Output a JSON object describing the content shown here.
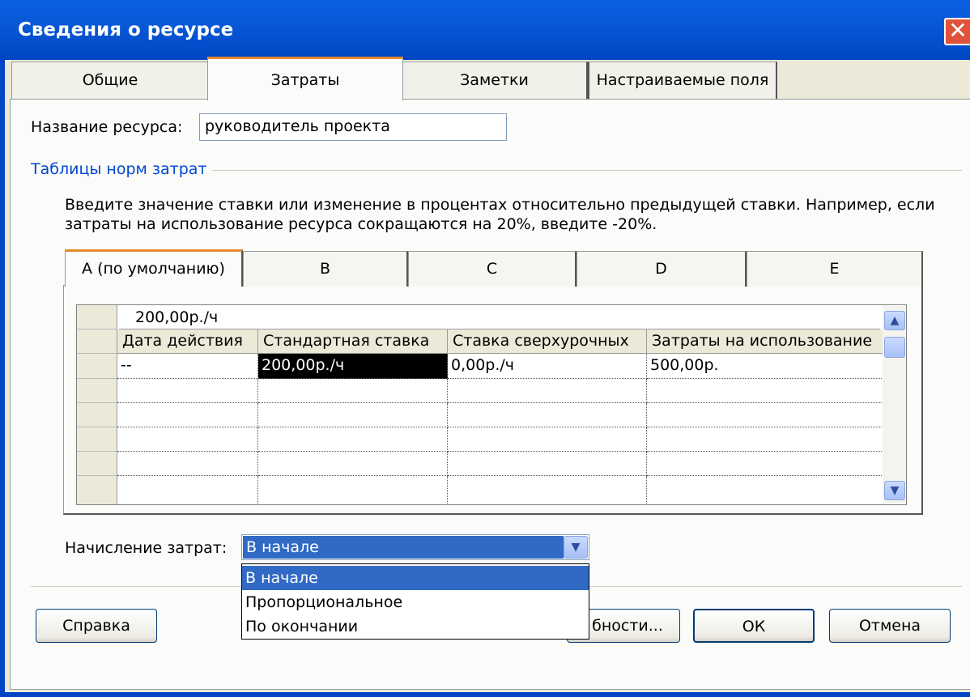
{
  "window": {
    "title": "Сведения о ресурсе",
    "close_glyph": "✕"
  },
  "tabs": [
    {
      "label": "Общие"
    },
    {
      "label": "Затраты"
    },
    {
      "label": "Заметки"
    },
    {
      "label": "Настраиваемые поля"
    }
  ],
  "resource_name": {
    "label": "Название ресурса:",
    "value": "руководитель проекта"
  },
  "rate_tables": {
    "group_label": "Таблицы норм затрат",
    "hint_line1": "Введите значение ставки или изменение в процентах относительно предыдущей ставки. Например, если",
    "hint_line2": "затраты на использование ресурса сокращаются на 20%, введите -20%.",
    "tabs": [
      {
        "label": "A (по умолчанию)"
      },
      {
        "label": "B"
      },
      {
        "label": "C"
      },
      {
        "label": "D"
      },
      {
        "label": "E"
      }
    ],
    "edit_value": "200,00р./ч",
    "columns": [
      "Дата действия",
      "Стандартная ставка",
      "Ставка сверхурочных",
      "Затраты на использование"
    ],
    "rows": [
      [
        "--",
        "200,00р./ч",
        "0,00р./ч",
        "500,00р."
      ]
    ],
    "scroll_up_glyph": "▲",
    "scroll_down_glyph": "▼"
  },
  "accrual": {
    "label": "Начисление затрат:",
    "selected": "В начале",
    "options": [
      "В начале",
      "Пропорциональное",
      "По окончании"
    ],
    "arrow_glyph": "▼"
  },
  "buttons": {
    "help": "Справка",
    "details": "бности...",
    "ok": "ОК",
    "cancel": "Отмена"
  }
}
